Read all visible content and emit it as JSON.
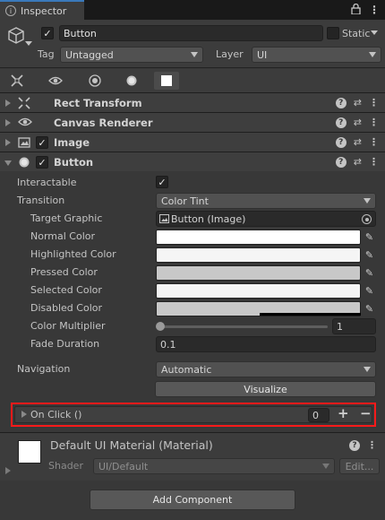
{
  "tab": {
    "title": "Inspector"
  },
  "gameobject": {
    "name": "Button",
    "static_label": "Static",
    "tag_label": "Tag",
    "tag_value": "Untagged",
    "layer_label": "Layer",
    "layer_value": "UI"
  },
  "components": {
    "rect_transform": "Rect Transform",
    "canvas_renderer": "Canvas Renderer",
    "image": "Image",
    "button": "Button"
  },
  "button_props": {
    "interactable": "Interactable",
    "transition": "Transition",
    "transition_value": "Color Tint",
    "target_graphic": "Target Graphic",
    "target_graphic_value": "Button (Image)",
    "normal_color": "Normal Color",
    "highlighted_color": "Highlighted Color",
    "pressed_color": "Pressed Color",
    "selected_color": "Selected Color",
    "disabled_color": "Disabled Color",
    "color_multiplier": "Color Multiplier",
    "color_multiplier_value": "1",
    "fade_duration": "Fade Duration",
    "fade_duration_value": "0.1",
    "navigation": "Navigation",
    "navigation_value": "Automatic",
    "visualize": "Visualize",
    "on_click": "On Click ()",
    "on_click_count": "0",
    "plus": "+",
    "minus": "−"
  },
  "colors": {
    "normal": "#ffffff",
    "highlighted": "#f5f5f5",
    "pressed": "#c8c8c8",
    "selected": "#f5f5f5",
    "disabled": "#c8c8c8"
  },
  "material": {
    "title": "Default UI Material (Material)",
    "shader_label": "Shader",
    "shader_value": "UI/Default",
    "edit": "Edit..."
  },
  "add_component": "Add Component"
}
